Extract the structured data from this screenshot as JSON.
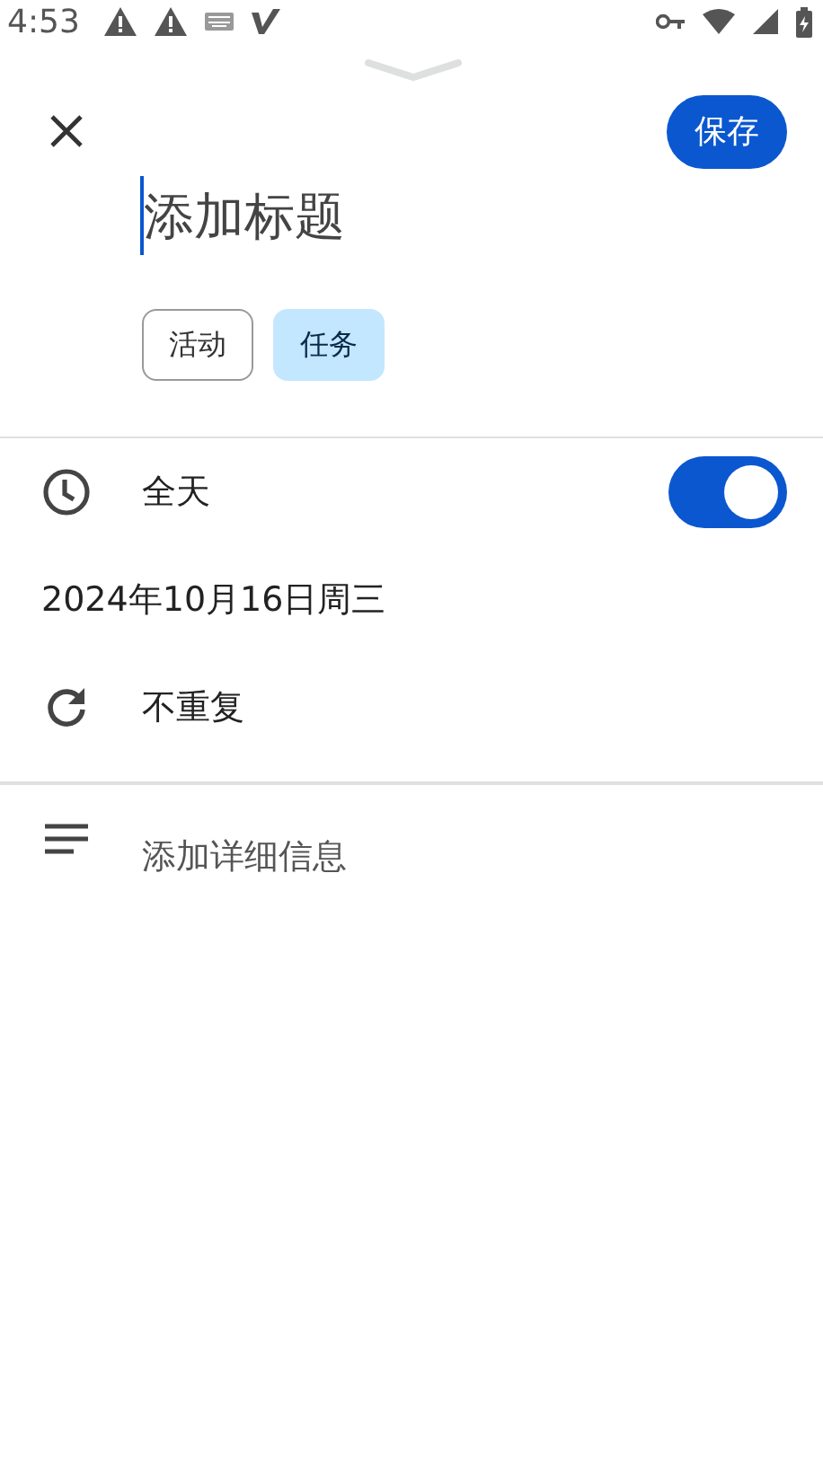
{
  "status_bar": {
    "time": "4:53"
  },
  "header": {
    "save_label": "保存"
  },
  "title_field": {
    "placeholder": "添加标题"
  },
  "type_chips": [
    {
      "label": "活动",
      "selected": false
    },
    {
      "label": "任务",
      "selected": true
    }
  ],
  "all_day": {
    "label": "全天",
    "on": true
  },
  "date": "2024年10月16日周三",
  "repeat": "不重复",
  "details": {
    "placeholder": "添加详细信息"
  }
}
